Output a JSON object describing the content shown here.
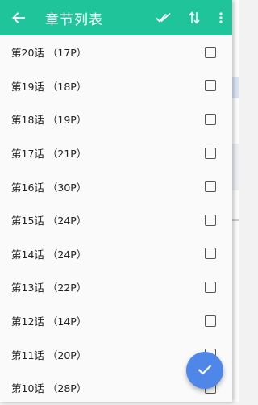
{
  "header": {
    "title": "章节列表",
    "back_icon": "arrow-left-icon",
    "actions": [
      {
        "name": "select-all-icon"
      },
      {
        "name": "sort-icon"
      },
      {
        "name": "more-vert-icon"
      }
    ]
  },
  "colors": {
    "appbar": "#1fc49b",
    "fab": "#4f87e8",
    "checkbox_border": "#555555"
  },
  "chapters": [
    {
      "label": "第20话 （17P）",
      "checked": false
    },
    {
      "label": "第19话 （18P）",
      "checked": false
    },
    {
      "label": "第18话 （19P）",
      "checked": false
    },
    {
      "label": "第17话 （21P）",
      "checked": false
    },
    {
      "label": "第16话 （30P）",
      "checked": false
    },
    {
      "label": "第15话 （24P）",
      "checked": false
    },
    {
      "label": "第14话 （24P）",
      "checked": false
    },
    {
      "label": "第13话 （22P）",
      "checked": false
    },
    {
      "label": "第12话 （14P）",
      "checked": false
    },
    {
      "label": "第11话 （20P）",
      "checked": false
    },
    {
      "label": "第10话 （28P）",
      "checked": false
    }
  ],
  "fab": {
    "icon": "check-icon"
  }
}
